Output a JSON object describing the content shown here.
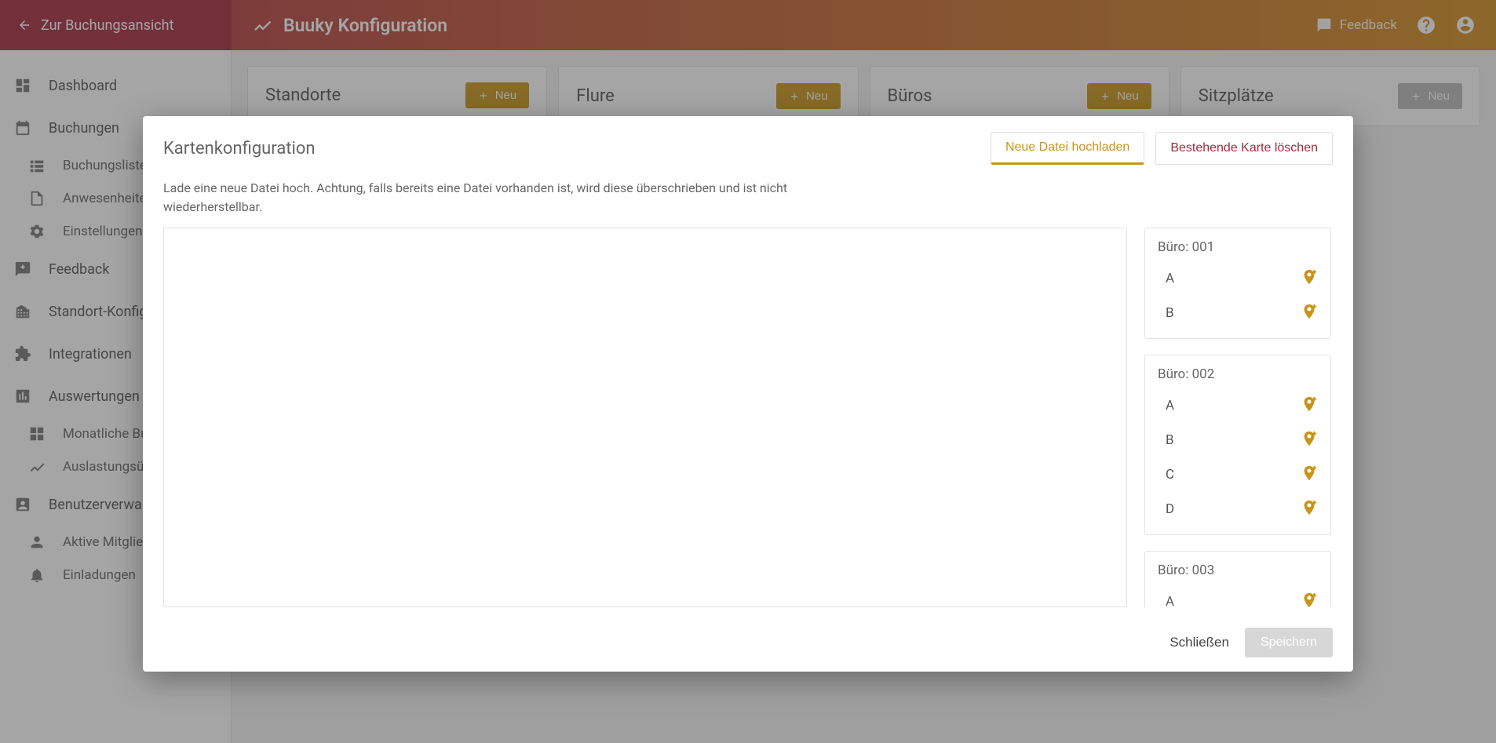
{
  "header": {
    "back_label": "Zur Buchungsansicht",
    "app_title": "Buuky Konfiguration",
    "feedback_label": "Feedback"
  },
  "sidebar": {
    "dashboard": "Dashboard",
    "bookings": "Buchungen",
    "bookings_sub": {
      "list": "Buchungsliste",
      "attendance": "Anwesenheiten",
      "settings": "Einstellungen"
    },
    "feedback": "Feedback",
    "location_config": "Standort-Konfiguration",
    "integrations": "Integrationen",
    "reports": "Auswertungen",
    "reports_sub": {
      "monthly": "Monatliche Buchungen",
      "utilization": "Auslastungsübersicht"
    },
    "user_mgmt": "Benutzerverwaltung",
    "user_sub": {
      "active": "Aktive Mitglieder",
      "invites": "Einladungen"
    }
  },
  "panels": {
    "locations": "Standorte",
    "floors": "Flure",
    "offices": "Büros",
    "seats": "Sitzplätze",
    "new_label": "Neu"
  },
  "modal": {
    "title": "Kartenkonfiguration",
    "upload_btn": "Neue Datei hochladen",
    "delete_btn": "Bestehende Karte löschen",
    "note": "Lade eine neue Datei hoch. Achtung, falls bereits eine Datei vorhanden ist, wird diese überschrieben und ist nicht wiederherstellbar.",
    "office_prefix": "Büro: ",
    "groups": [
      {
        "id": "001",
        "seats": [
          "A",
          "B"
        ]
      },
      {
        "id": "002",
        "seats": [
          "A",
          "B",
          "C",
          "D"
        ]
      },
      {
        "id": "003",
        "seats": [
          "A"
        ]
      }
    ],
    "close_label": "Schließen",
    "save_label": "Speichern"
  }
}
